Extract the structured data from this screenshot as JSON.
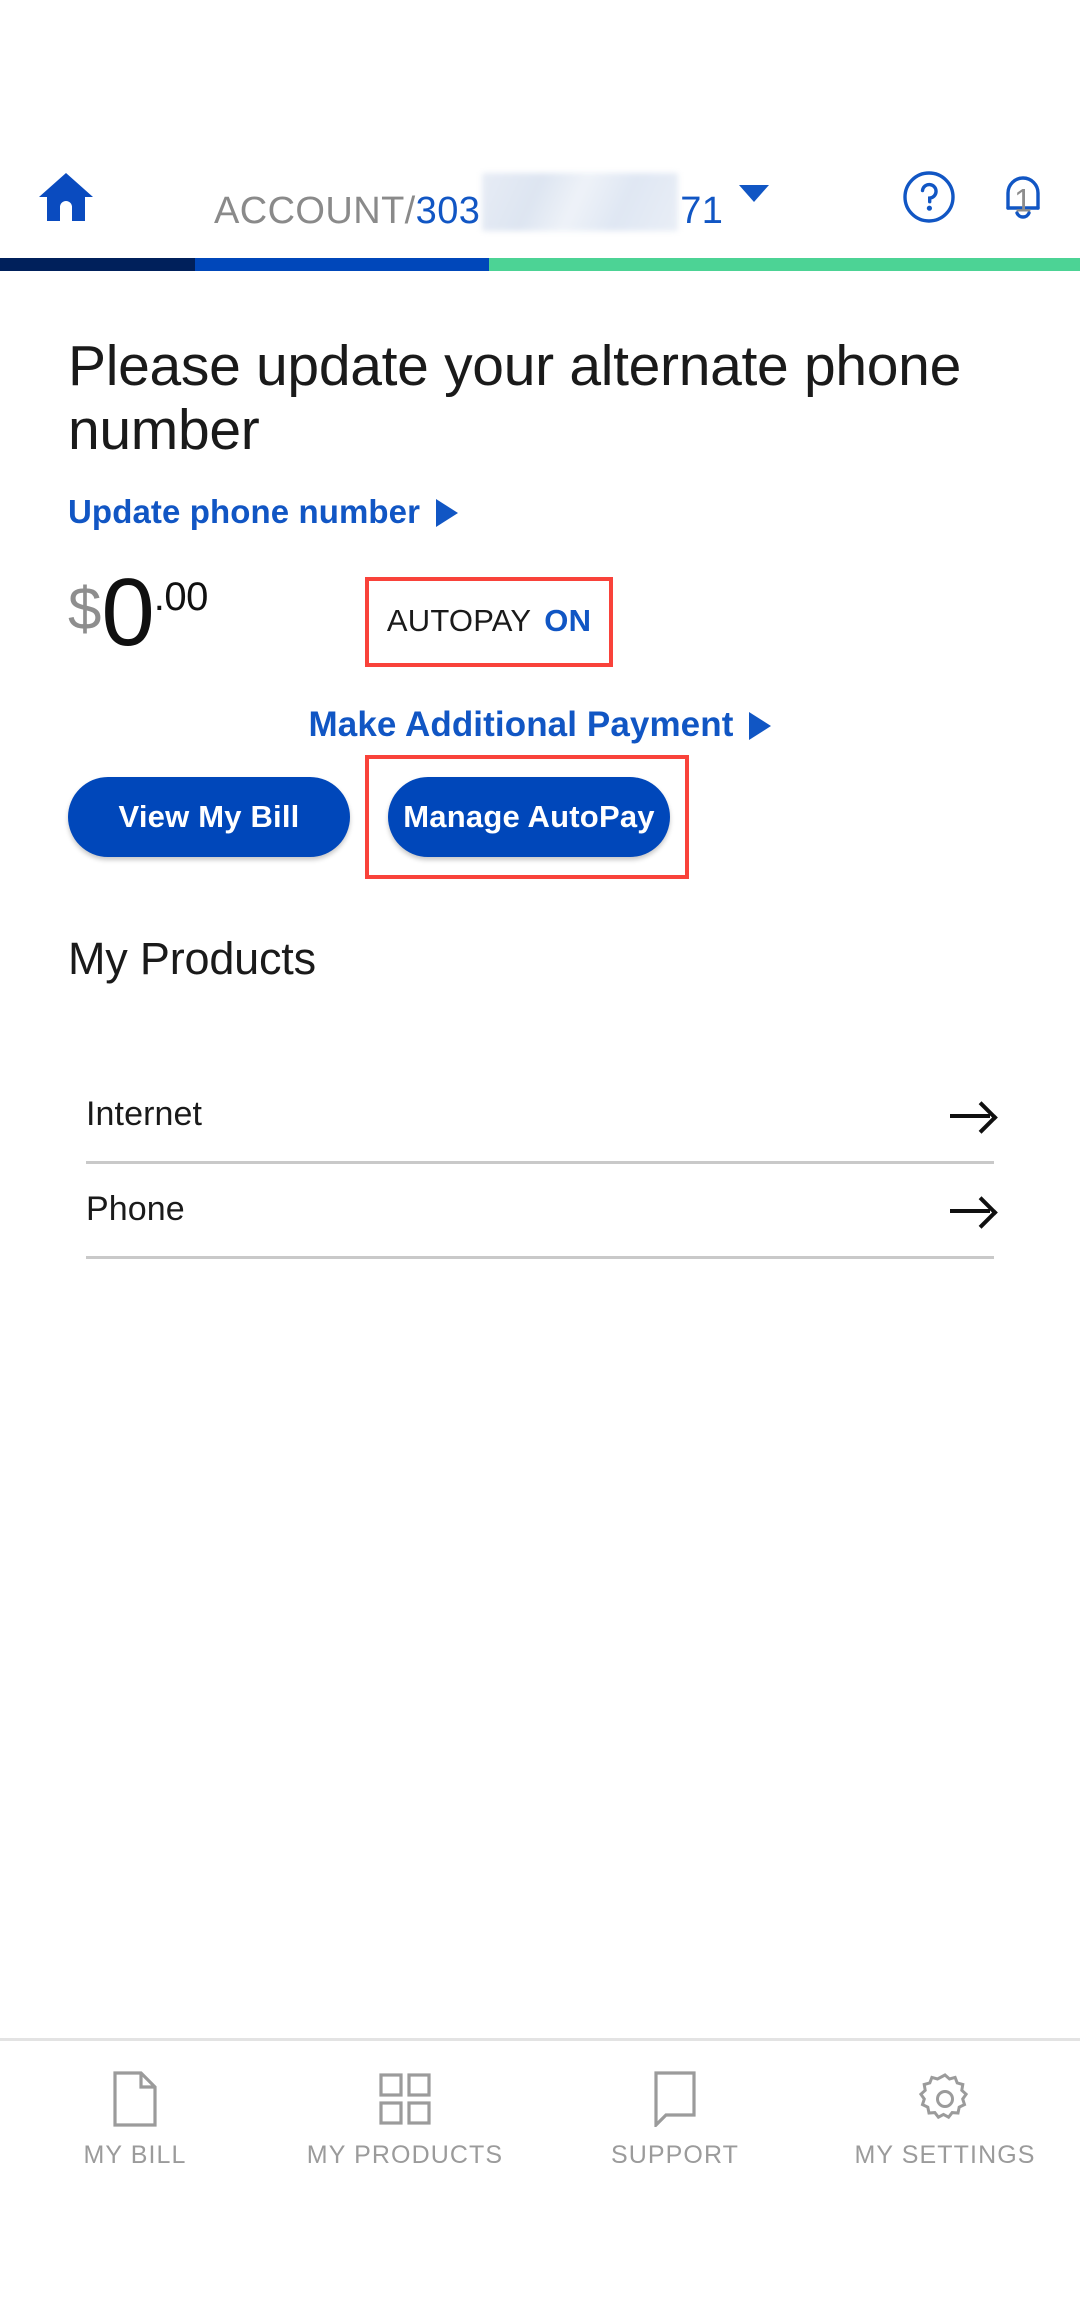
{
  "header": {
    "home_icon": "home-icon",
    "account_label": "ACCOUNT/",
    "account_prefix": "303",
    "account_suffix": "71",
    "account_redacted": true,
    "dropdown_icon": "chevron-down-icon",
    "help_icon": "help-circle-icon",
    "notifications_icon": "notification-bell-icon",
    "notifications_count": "1"
  },
  "stripe": {
    "colors": [
      "#00205b",
      "#0047ba",
      "#4cd395"
    ]
  },
  "alert": {
    "title": "Please update your alternate phone number",
    "link_label": "Update phone number",
    "link_arrow_icon": "triangle-right-icon"
  },
  "balance": {
    "currency_symbol": "$",
    "whole": "0",
    "cents": ".00",
    "autopay_label": "AUTOPAY",
    "autopay_state": "ON",
    "autopay_highlight_color": "#f9423a"
  },
  "payment": {
    "additional_payment_label": "Make Additional Payment",
    "additional_payment_arrow_icon": "triangle-right-icon",
    "view_bill_label": "View My Bill",
    "manage_autopay_label": "Manage AutoPay",
    "manage_autopay_highlight_color": "#f9423a",
    "button_color": "#0047ba"
  },
  "products": {
    "section_title": "My Products",
    "items": [
      {
        "name": "Internet",
        "arrow_icon": "arrow-right-icon"
      },
      {
        "name": "Phone",
        "arrow_icon": "arrow-right-icon"
      }
    ]
  },
  "bottom_nav": {
    "items": [
      {
        "label": "MY BILL",
        "icon": "document-icon"
      },
      {
        "label": "MY PRODUCTS",
        "icon": "grid-icon"
      },
      {
        "label": "SUPPORT",
        "icon": "chat-bubble-icon"
      },
      {
        "label": "MY SETTINGS",
        "icon": "gear-icon"
      }
    ]
  }
}
